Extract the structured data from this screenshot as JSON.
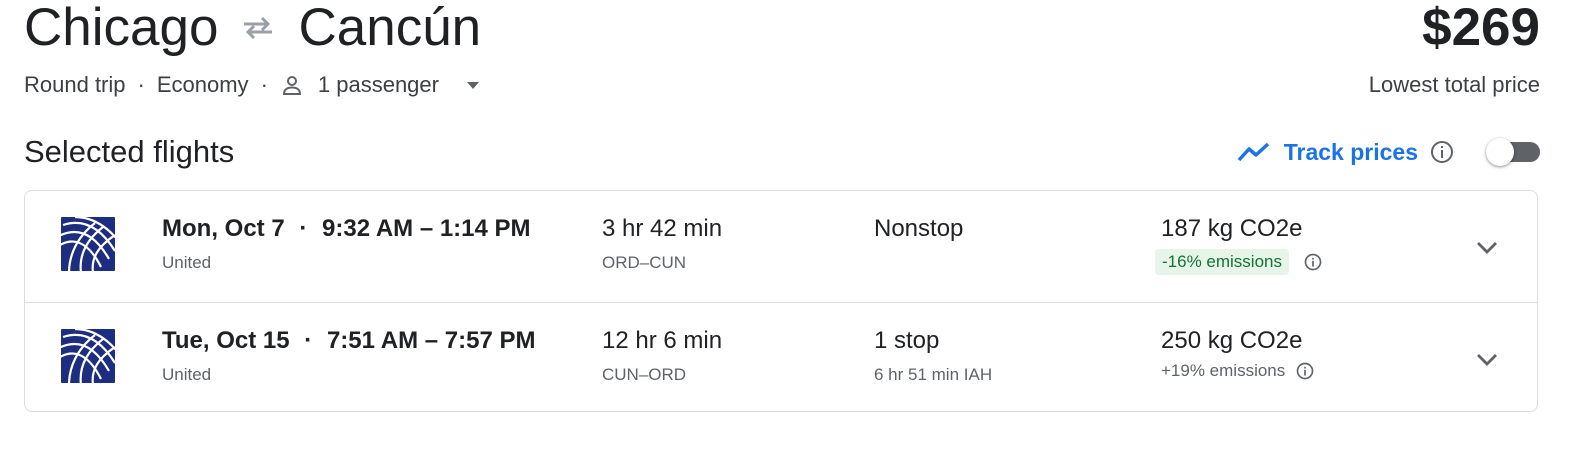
{
  "header": {
    "origin": "Chicago",
    "destination": "Cancún",
    "price": "$269",
    "price_caption": "Lowest total price",
    "trip_type": "Round trip",
    "cabin": "Economy",
    "passengers": "1 passenger",
    "separator": "·"
  },
  "section": {
    "title": "Selected flights",
    "track_prices_label": "Track prices",
    "track_prices_enabled": false
  },
  "colors": {
    "accent": "#1a73e8",
    "emissions_good_bg": "#e6f4ea",
    "emissions_good_text": "#137333",
    "airline_logo": "#1d2d7f"
  },
  "flights": [
    {
      "date": "Mon, Oct 7",
      "times": "9:32 AM – 1:14 PM",
      "airline": "United",
      "duration": "3 hr 42 min",
      "route": "ORD–CUN",
      "stops": "Nonstop",
      "layover": "",
      "emissions": "187 kg CO2e",
      "emissions_delta": "-16% emissions",
      "emissions_highlight": true
    },
    {
      "date": "Tue, Oct 15",
      "times": "7:51 AM – 7:57 PM",
      "airline": "United",
      "duration": "12 hr 6 min",
      "route": "CUN–ORD",
      "stops": "1 stop",
      "layover": "6 hr 51 min IAH",
      "emissions": "250 kg CO2e",
      "emissions_delta": "+19% emissions",
      "emissions_highlight": false
    }
  ],
  "icons": {
    "swap": "swap-arrows-icon",
    "person": "person-icon",
    "dropdown": "caret-down-icon",
    "trend": "trend-line-icon",
    "info": "info-icon",
    "expand": "chevron-down-icon",
    "airline_logo": "united-globe-logo"
  }
}
